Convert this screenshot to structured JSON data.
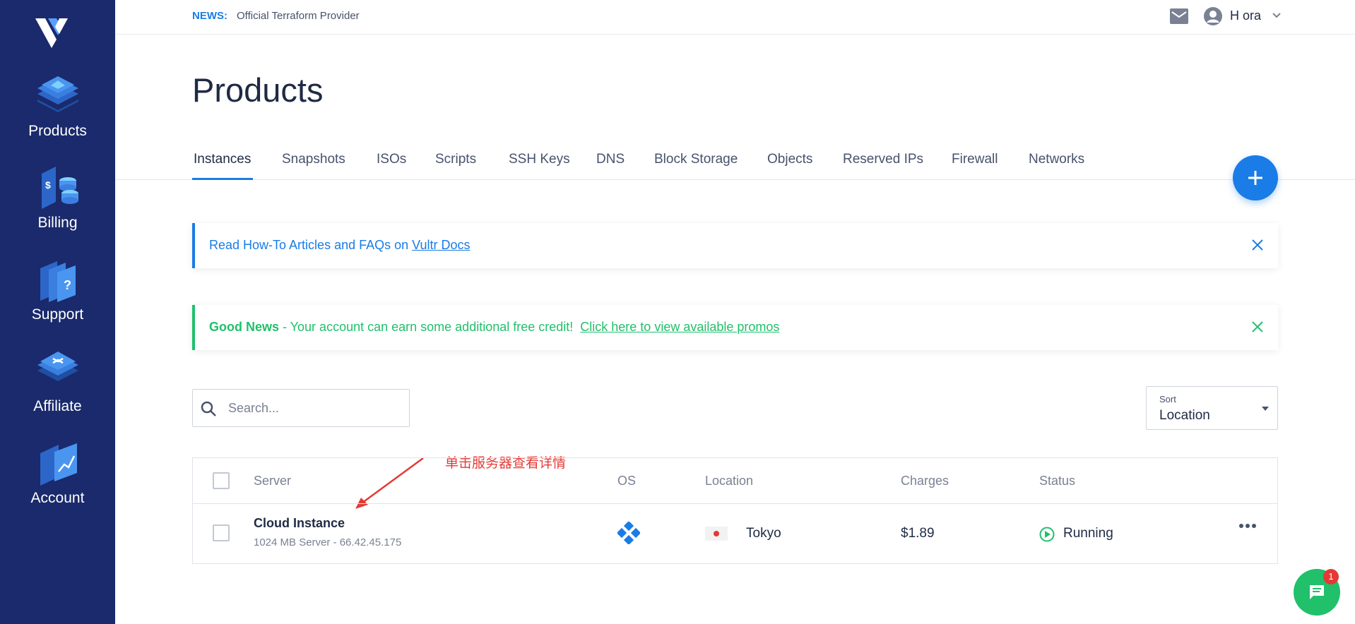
{
  "sidebar": {
    "items": [
      {
        "label": "Products",
        "icon": "products-icon"
      },
      {
        "label": "Billing",
        "icon": "billing-icon"
      },
      {
        "label": "Support",
        "icon": "support-icon"
      },
      {
        "label": "Affiliate",
        "icon": "affiliate-icon"
      },
      {
        "label": "Account",
        "icon": "account-icon"
      }
    ]
  },
  "topbar": {
    "news_tag": "NEWS:",
    "news_text": "Official Terraform Provider",
    "user_name": "H ora"
  },
  "page": {
    "title": "Products"
  },
  "tabs": [
    {
      "label": "Instances",
      "active": true
    },
    {
      "label": "Snapshots"
    },
    {
      "label": "ISOs"
    },
    {
      "label": "Scripts"
    },
    {
      "label": "SSH Keys"
    },
    {
      "label": "DNS"
    },
    {
      "label": "Block Storage"
    },
    {
      "label": "Objects"
    },
    {
      "label": "Reserved IPs"
    },
    {
      "label": "Firewall"
    },
    {
      "label": "Networks"
    }
  ],
  "banners": {
    "docs": {
      "text": "Read How-To Articles and FAQs on ",
      "link": "Vultr Docs"
    },
    "promo": {
      "bold": "Good News",
      "text": " - Your account can earn some additional free credit!  ",
      "link": "Click here to view available promos"
    }
  },
  "search": {
    "placeholder": "Search..."
  },
  "sort": {
    "label": "Sort",
    "value": "Location"
  },
  "table": {
    "headers": {
      "server": "Server",
      "os": "OS",
      "location": "Location",
      "charges": "Charges",
      "status": "Status"
    },
    "rows": [
      {
        "name": "Cloud Instance",
        "sub": "1024 MB Server - 66.42.45.175",
        "location": "Tokyo",
        "charges": "$1.89",
        "status": "Running"
      }
    ]
  },
  "annotation": {
    "text": "单击服务器查看详情"
  },
  "chat": {
    "badge": "1"
  },
  "colors": {
    "sidebar": "#1a2a6c",
    "accent": "#1a7ce6",
    "success": "#21c06b",
    "alert": "#e53935"
  }
}
